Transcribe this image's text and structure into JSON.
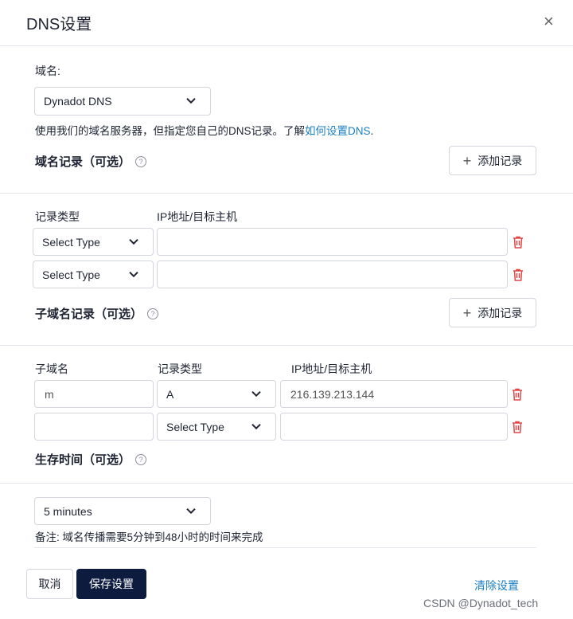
{
  "dialog": {
    "title": "DNS设置",
    "close_label": "×"
  },
  "domain": {
    "label": "域名:",
    "selected": "Dynadot DNS",
    "hint_text": "使用我们的域名服务器，但指定您自己的DNS记录。了解",
    "hint_link": "如何设置DNS",
    "hint_end": "."
  },
  "domain_records": {
    "title": "域名记录（可选）",
    "add_label": "添加记录",
    "col_type": "记录类型",
    "col_target": "IP地址/目标主机",
    "rows": [
      {
        "type": "Select Type",
        "target": ""
      },
      {
        "type": "Select Type",
        "target": ""
      }
    ]
  },
  "subdomain_records": {
    "title": "子域名记录（可选）",
    "add_label": "添加记录",
    "col_sub": "子域名",
    "col_type": "记录类型",
    "col_target": "IP地址/目标主机",
    "rows": [
      {
        "sub": "m",
        "type": "A",
        "target": "216.139.213.144"
      },
      {
        "sub": "",
        "type": "Select Type",
        "target": ""
      }
    ]
  },
  "ttl": {
    "title": "生存时间（可选）",
    "selected": "5 minutes",
    "note": "备注: 域名传播需要5分钟到48小时的时间来完成"
  },
  "footer": {
    "cancel_label": "取消",
    "save_label": "保存设置",
    "clear_label": "清除设置"
  },
  "watermark": "CSDN @Dynadot_tech",
  "colors": {
    "primary_button": "#0d1b3e",
    "link": "#1a7fc1",
    "delete_icon": "#e04848"
  }
}
